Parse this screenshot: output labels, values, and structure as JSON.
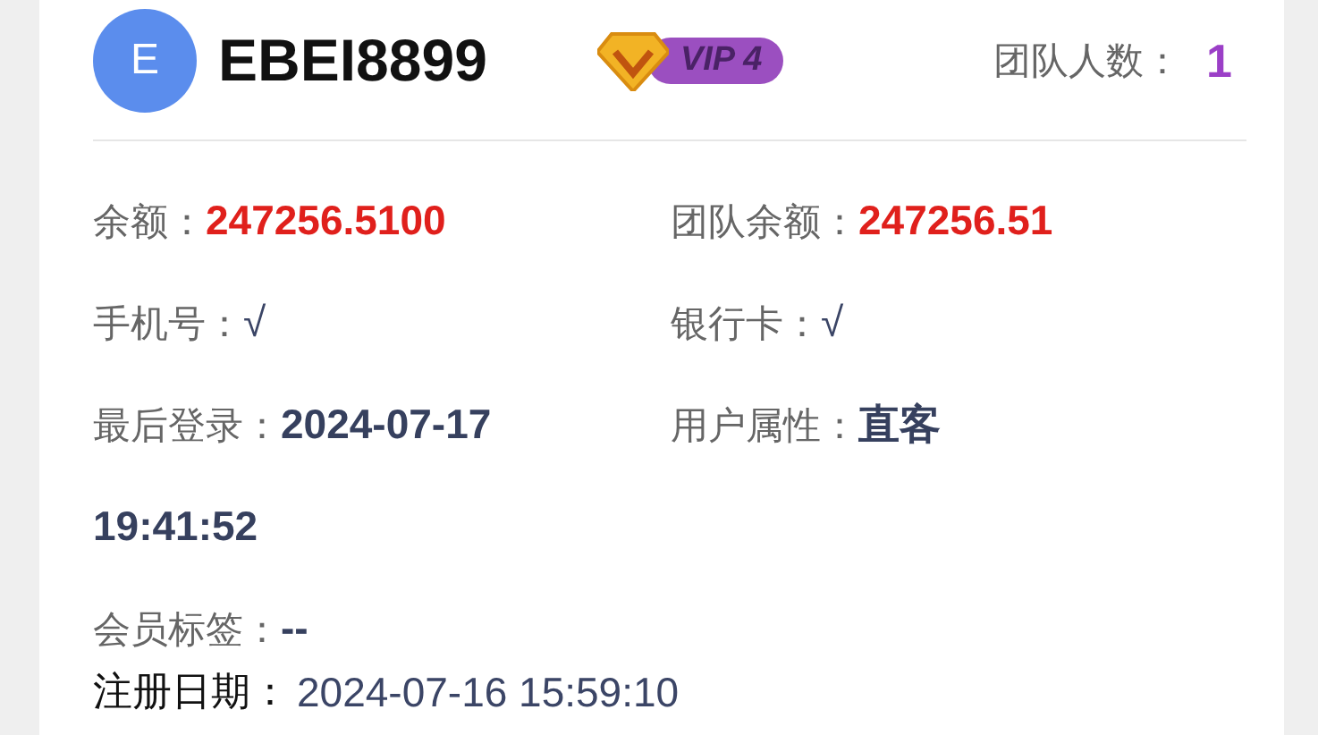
{
  "user": {
    "avatar_letter": "E",
    "username": "EBEI8899",
    "vip_badge": "VIP 4",
    "team_size_label": "团队人数：",
    "team_size": "1"
  },
  "fields": [
    {
      "label": "余额：",
      "value": "247256.5100",
      "kind": "amount"
    },
    {
      "label": "团队余额：",
      "value": "247256.51",
      "kind": "amount"
    },
    {
      "label": "手机号：",
      "value": "√",
      "kind": "check"
    },
    {
      "label": "银行卡：",
      "value": "√",
      "kind": "check"
    },
    {
      "label": "最后登录：",
      "value": "2024-07-17 19:41:52",
      "kind": "bold"
    },
    {
      "label": "用户属性：",
      "value": "直客",
      "kind": "bold"
    },
    {
      "label": "会员标签：",
      "value": "--",
      "kind": "bold"
    }
  ],
  "registration": {
    "label": "注册日期：",
    "value": "2024-07-16 15:59:10"
  }
}
